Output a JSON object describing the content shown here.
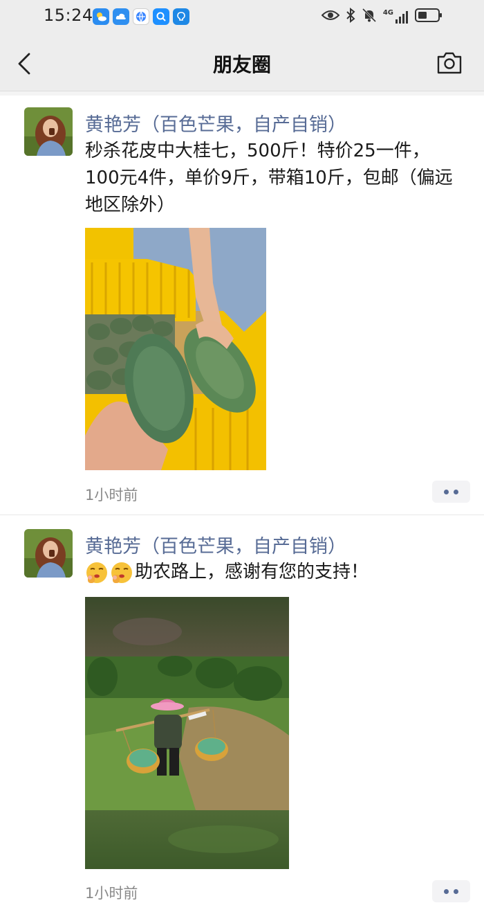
{
  "status_bar": {
    "time": "15:24",
    "network": "4G",
    "app_icons": [
      "weather-icon",
      "cloud-icon",
      "browser-icon",
      "search-app-icon",
      "bulb-icon"
    ],
    "right_icons": [
      "eye-icon",
      "bluetooth-icon",
      "mute-icon",
      "signal-icon",
      "battery-icon"
    ]
  },
  "header": {
    "title": "朋友圈",
    "back_icon": "chevron-left-icon",
    "camera_icon": "camera-icon"
  },
  "colors": {
    "link": "#576b95",
    "nav_bg": "#ededed",
    "timestamp": "#8a8a8a"
  },
  "posts": [
    {
      "author": "黄艳芳（百色芒果，自产自销）",
      "text": "秒杀花皮中大桂七，500斤！特价25一件，100元4件，单价9斤，带箱10斤，包邮（偏远地区除外）",
      "time": "1小时前",
      "image": "mangoes-in-hands-photo"
    },
    {
      "author": "黄艳芳（百色芒果，自产自销）",
      "emoji_icons": [
        "shushing-face-emoji",
        "shushing-face-emoji"
      ],
      "text": "助农路上，感谢有您的支持！",
      "time": "1小时前",
      "image": "farmer-carrying-mango-baskets-photo"
    }
  ]
}
